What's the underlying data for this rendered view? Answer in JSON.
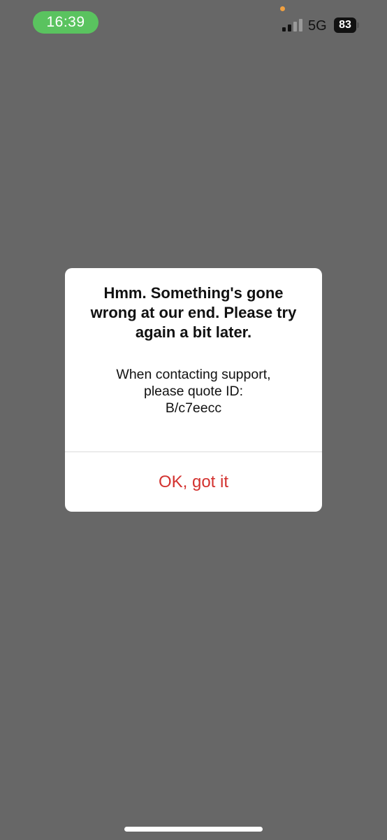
{
  "status_bar": {
    "time": "16:39",
    "network": "5G",
    "battery_level": "83",
    "signal_icon": "cellular-signal-icon",
    "battery_icon": "battery-icon"
  },
  "dialog": {
    "title": "Hmm. Something's gone wrong at our end. Please try again a bit later.",
    "message_line1": "When contacting support,",
    "message_line2": "please quote ID:",
    "message_line3": "B/c7eecc",
    "ok_button": "OK, got it"
  },
  "colors": {
    "overlay": "#676767",
    "time_pill": "#5ac35f",
    "accent_red": "#d3322f",
    "privacy_dot": "#f0a040"
  }
}
